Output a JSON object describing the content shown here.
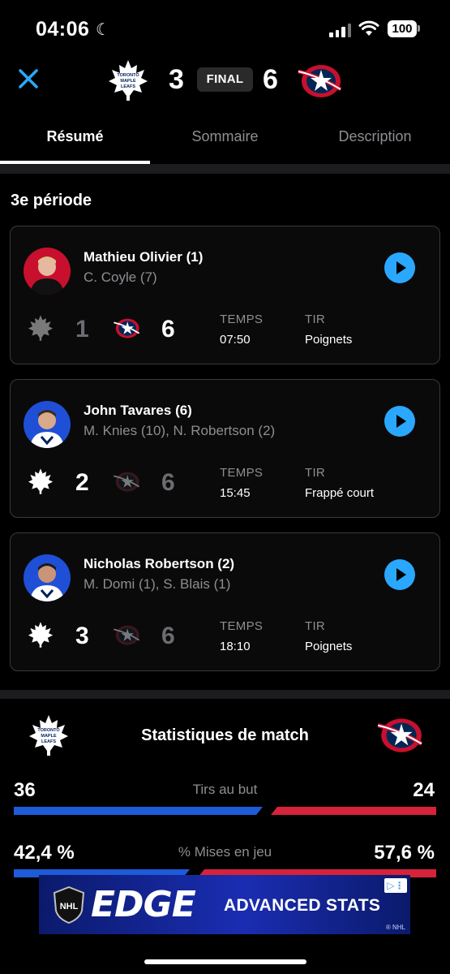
{
  "status_bar": {
    "time": "04:06",
    "battery": "100"
  },
  "header": {
    "home_team": "Toronto Maple Leafs",
    "away_team": "Columbus Blue Jackets",
    "home_score": "3",
    "away_score": "6",
    "status": "FINAL"
  },
  "tabs": [
    {
      "label": "Résumé",
      "active": true
    },
    {
      "label": "Sommaire",
      "active": false
    },
    {
      "label": "Description",
      "active": false
    }
  ],
  "section_title": "3e période",
  "goals": [
    {
      "scorer": "Mathieu Olivier (1)",
      "assists": "C. Coyle (7)",
      "scoring_team": "CBJ",
      "home_score": "1",
      "away_score": "6",
      "time_label": "TEMPS",
      "time": "07:50",
      "shot_label": "TIR",
      "shot": "Poignets",
      "avatar_color": "#c8102e"
    },
    {
      "scorer": "John Tavares (6)",
      "assists": "M. Knies (10), N. Robertson (2)",
      "scoring_team": "TOR",
      "home_score": "2",
      "away_score": "6",
      "time_label": "TEMPS",
      "time": "15:45",
      "shot_label": "TIR",
      "shot": "Frappé court",
      "avatar_color": "#1f4fd6"
    },
    {
      "scorer": "Nicholas Robertson (2)",
      "assists": "M. Domi (1), S. Blais (1)",
      "scoring_team": "TOR",
      "home_score": "3",
      "away_score": "6",
      "time_label": "TEMPS",
      "time": "18:10",
      "shot_label": "TIR",
      "shot": "Poignets",
      "avatar_color": "#1f4fd6"
    }
  ],
  "stats": {
    "title": "Statistiques de match",
    "rows": [
      {
        "label": "Tirs au but",
        "home": "36",
        "away": "24",
        "home_share": 0.6
      },
      {
        "label": "% Mises en jeu",
        "home": "42,4 %",
        "away": "57,6 %",
        "home_share": 0.424
      }
    ]
  },
  "ad": {
    "brand": "EDGE",
    "tagline": "ADVANCED STATS",
    "copyright": "® NHL"
  },
  "colors": {
    "accent": "#2aa8ff",
    "home_bar": "#1e5bd8",
    "away_bar": "#d6223a"
  }
}
